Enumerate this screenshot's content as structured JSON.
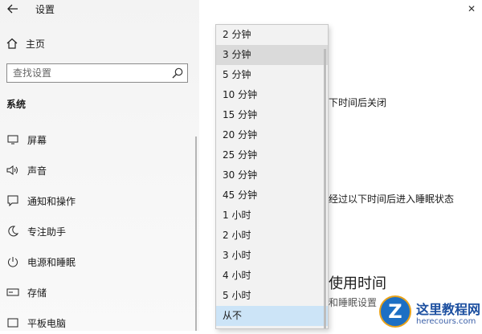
{
  "window": {
    "title": "设置",
    "close_label": "✕"
  },
  "sidebar": {
    "home_label": "主页",
    "search_placeholder": "查找设置",
    "section_label": "系统",
    "items": [
      {
        "label": "屏幕",
        "icon": "monitor-icon"
      },
      {
        "label": "声音",
        "icon": "speaker-icon"
      },
      {
        "label": "通知和操作",
        "icon": "notification-icon"
      },
      {
        "label": "专注助手",
        "icon": "moon-icon"
      },
      {
        "label": "电源和睡眠",
        "icon": "power-icon"
      },
      {
        "label": "存储",
        "icon": "storage-icon"
      },
      {
        "label": "平板电脑",
        "icon": "tablet-icon"
      }
    ]
  },
  "main": {
    "screen_off_text": "下时间后关闭",
    "sleep_text": "经过以下时间后进入睡眠状态",
    "usage_heading": "使用时间",
    "usage_sub": "和睡眠设置"
  },
  "dropdown": {
    "options": [
      "2 分钟",
      "3 分钟",
      "5 分钟",
      "10 分钟",
      "15 分钟",
      "20 分钟",
      "25 分钟",
      "30 分钟",
      "45 分钟",
      "1 小时",
      "2 小时",
      "3 小时",
      "4 小时",
      "5 小时",
      "从不"
    ],
    "hovered": "3 分钟",
    "selected": "从不"
  },
  "watermark": {
    "title": "这里教程网",
    "url": "herecours.com",
    "badge": "Z"
  },
  "colors": {
    "selected_bg": "#cce4f7",
    "hover_bg": "#dadada",
    "watermark_blue": "#1c6fc4"
  }
}
